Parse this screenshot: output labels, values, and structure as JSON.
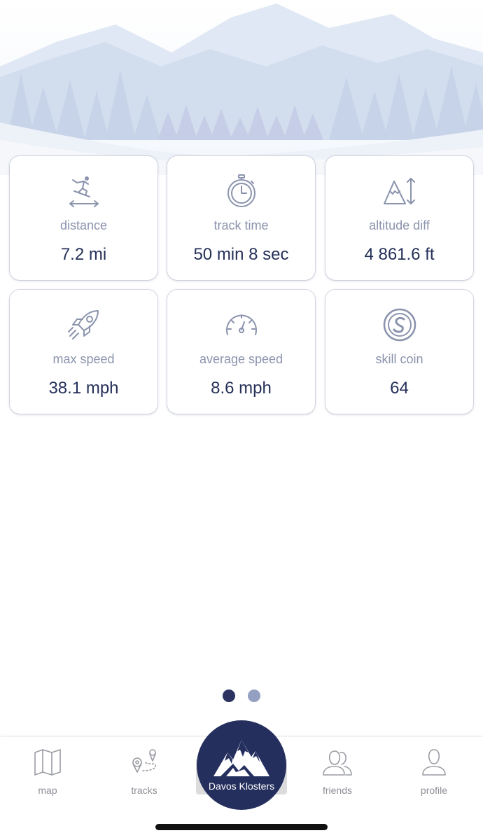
{
  "stats": [
    {
      "icon": "skier-icon",
      "label": "distance",
      "value": "7.2 mi"
    },
    {
      "icon": "stopwatch-icon",
      "label": "track time",
      "value": "50 min 8 sec"
    },
    {
      "icon": "altitude-icon",
      "label": "altitude diff",
      "value": "4 861.6 ft"
    },
    {
      "icon": "rocket-icon",
      "label": "max speed",
      "value": "38.1 mph"
    },
    {
      "icon": "speedometer-icon",
      "label": "average speed",
      "value": "8.6 mph"
    },
    {
      "icon": "skill-coin-icon",
      "label": "skill coin",
      "value": "64"
    }
  ],
  "pager": {
    "pages": 2,
    "active": 0
  },
  "tabs": {
    "map": {
      "label": "map",
      "icon": "map-icon"
    },
    "tracks": {
      "label": "tracks",
      "icon": "tracks-icon"
    },
    "center": {
      "label": "Davos Klosters",
      "icon": "mountain-logo-icon"
    },
    "friends": {
      "label": "friends",
      "icon": "friends-icon"
    },
    "profile": {
      "label": "profile",
      "icon": "profile-icon"
    }
  },
  "colors": {
    "accent": "#252f5e",
    "label": "#8b93ad",
    "value": "#253058",
    "icon": "#8b93ad"
  }
}
